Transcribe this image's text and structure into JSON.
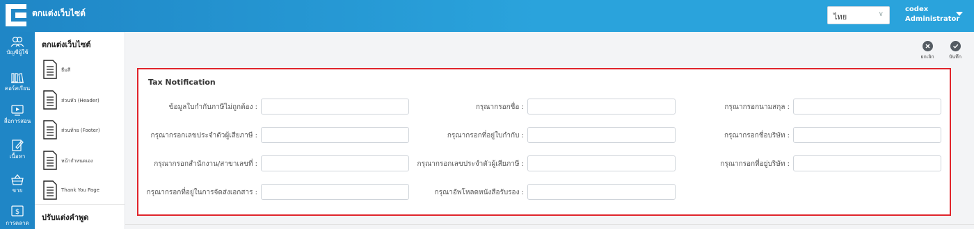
{
  "header": {
    "title": "ตกแต่งเว็บไซต์",
    "language": "ไทย",
    "user_name": "codex",
    "user_role": "Administrator"
  },
  "nav": [
    {
      "label": "บัญชีผู้ใช้",
      "icon": "users-icon"
    },
    {
      "label": "คอร์สเรียน",
      "icon": "library-icon"
    },
    {
      "label": "สื่อการสอน",
      "icon": "video-icon"
    },
    {
      "label": "เนื้อหา",
      "icon": "edit-icon"
    },
    {
      "label": "ขาย",
      "icon": "basket-icon"
    },
    {
      "label": "การตลาด",
      "icon": "dollar-icon"
    }
  ],
  "submenu": {
    "title": "ตกแต่งเว็บไซต์",
    "items": [
      "ธีมสี",
      "ส่วนหัว (Header)",
      "ส่วนท้าย (Footer)",
      "หน้ากำหนดเอง",
      "Thank You Page"
    ],
    "section2_title": "ปรับแต่งคำพูด"
  },
  "actions": {
    "cancel": "ยกเลิก",
    "save": "บันทึก"
  },
  "form": {
    "title": "Tax Notification",
    "fields": [
      {
        "label": "ข้อมูลใบกำกับภาษีไม่ถูกต้อง",
        "value": ""
      },
      {
        "label": "กรุณากรอกชื่อ",
        "value": ""
      },
      {
        "label": "กรุณากรอกนามสกุล",
        "value": ""
      },
      {
        "label": "กรุณากรอกเลขประจำตัวผู้เสียภาษี",
        "value": ""
      },
      {
        "label": "กรุณากรอกที่อยู่ใบกำกับ",
        "value": ""
      },
      {
        "label": "กรุณากรอกชื่อบริษัท",
        "value": ""
      },
      {
        "label": "กรุณากรอกสำนักงาน/สาขาเลขที่",
        "value": ""
      },
      {
        "label": "กรุณากรอกเลขประจำตัวผู้เสียภาษี",
        "value": ""
      },
      {
        "label": "กรุณากรอกที่อยู่บริษัท",
        "value": ""
      },
      {
        "label": "กรุณากรอกที่อยู่ในการจัดส่งเอกสาร",
        "value": ""
      },
      {
        "label": "กรุณาอัพโหลดหนังสือรับรอง",
        "value": ""
      }
    ]
  },
  "colors": {
    "brand": "#1f86c6",
    "highlight_border": "#e0242b"
  }
}
